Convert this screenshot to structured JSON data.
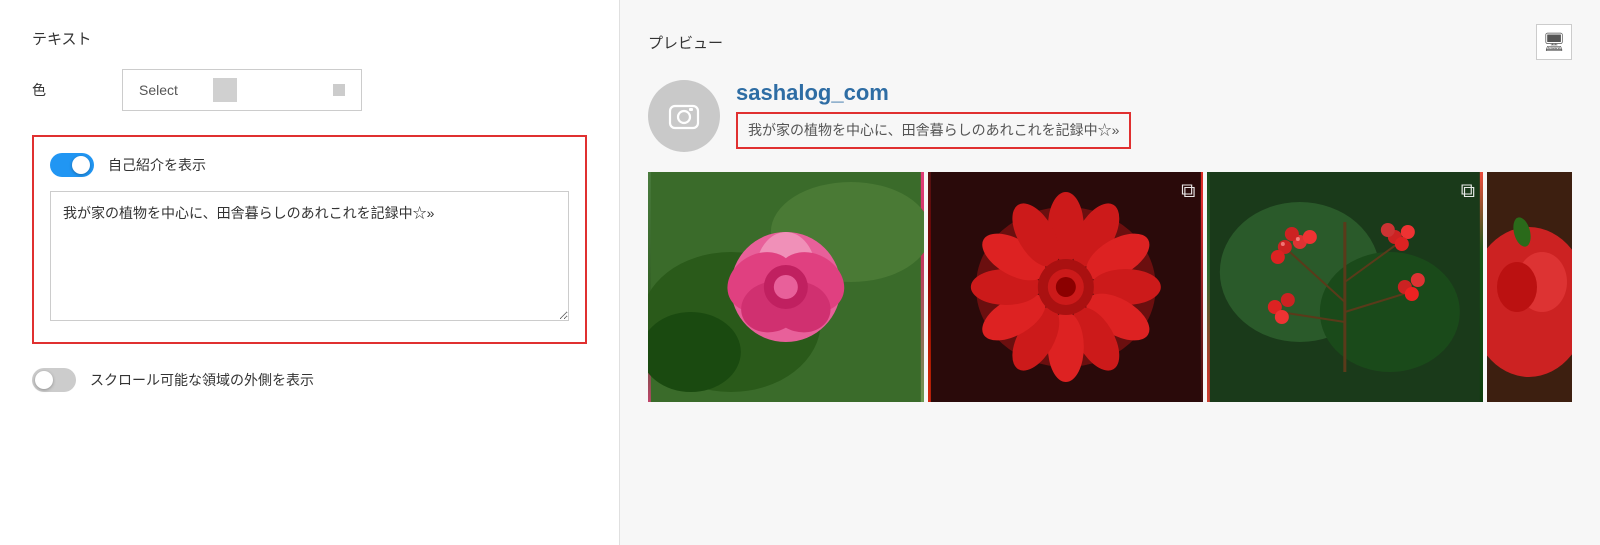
{
  "left": {
    "section_title": "テキスト",
    "color_label": "色",
    "select_placeholder": "Select",
    "highlight_box": {
      "toggle_label": "自己紹介を表示",
      "bio_text": "我が家の植物を中心に、田舎暮らしのあれこれを記録中☆»"
    },
    "scroll_toggle_label": "スクロール可能な領域の外側を表示"
  },
  "right": {
    "preview_title": "プレビュー",
    "monitor_icon": "🖥",
    "profile": {
      "name": "sashalog_com",
      "bio": "我が家の植物を中心に、田舎暮らしのあれこれを記録中☆»"
    },
    "photos": [
      {
        "id": 1,
        "type": "single",
        "icon": "⧉"
      },
      {
        "id": 2,
        "type": "multi",
        "icon": "⧉"
      },
      {
        "id": 3,
        "type": "multi",
        "icon": "⧉"
      },
      {
        "id": 4,
        "type": "single",
        "icon": ""
      }
    ]
  }
}
